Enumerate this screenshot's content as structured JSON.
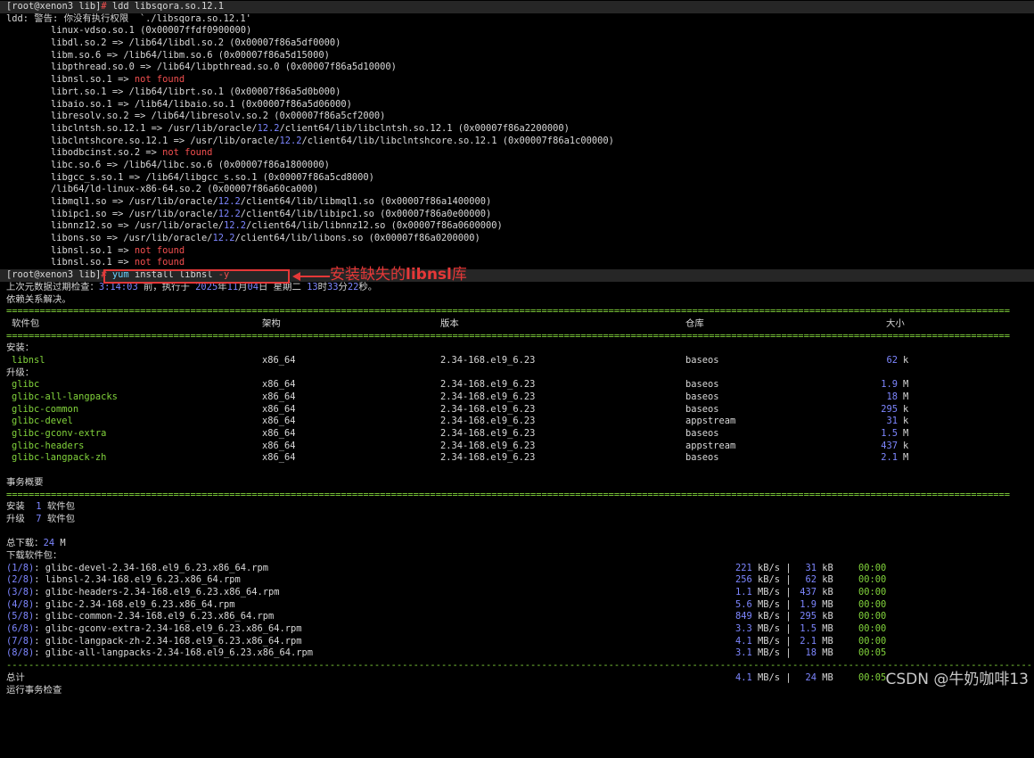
{
  "ldd": {
    "prompt": "[root@xenon3 lib]",
    "hash": "#",
    "command": "ldd libsqora.so.12.1",
    "warning": "ldd: 警告: 你没有执行权限  `./libsqora.so.12.1'",
    "entries": [
      {
        "lib": "linux-vdso.so.1",
        "arrow": "",
        "target": "",
        "ver": "",
        "rest": "",
        "addr": "(0x00007ffdf0900000)"
      },
      {
        "lib": "libdl.so.2",
        "arrow": "=>",
        "target": "/lib64/libdl.so.2",
        "ver": "",
        "rest": "",
        "addr": "(0x00007f86a5df0000)"
      },
      {
        "lib": "libm.so.6",
        "arrow": "=>",
        "target": "/lib64/libm.so.6",
        "ver": "",
        "rest": "",
        "addr": "(0x00007f86a5d15000)"
      },
      {
        "lib": "libpthread.so.0",
        "arrow": "=>",
        "target": "/lib64/libpthread.so.0",
        "ver": "",
        "rest": "",
        "addr": "(0x00007f86a5d10000)"
      },
      {
        "lib": "libnsl.so.1",
        "arrow": "=>",
        "target": "not found",
        "notfound": true
      },
      {
        "lib": "librt.so.1",
        "arrow": "=>",
        "target": "/lib64/librt.so.1",
        "ver": "",
        "rest": "",
        "addr": "(0x00007f86a5d0b000)"
      },
      {
        "lib": "libaio.so.1",
        "arrow": "=>",
        "target": "/lib64/libaio.so.1",
        "ver": "",
        "rest": "",
        "addr": "(0x00007f86a5d06000)"
      },
      {
        "lib": "libresolv.so.2",
        "arrow": "=>",
        "target": "/lib64/libresolv.so.2",
        "ver": "",
        "rest": "",
        "addr": "(0x00007f86a5cf2000)"
      },
      {
        "lib": "libclntsh.so.12.1",
        "arrow": "=>",
        "target": "/usr/lib/oracle/",
        "ver": "12.2",
        "rest": "/client64/lib/libclntsh.so.12.1",
        "addr": "(0x00007f86a2200000)"
      },
      {
        "lib": "libclntshcore.so.12.1",
        "arrow": "=>",
        "target": "/usr/lib/oracle/",
        "ver": "12.2",
        "rest": "/client64/lib/libclntshcore.so.12.1",
        "addr": "(0x00007f86a1c00000)"
      },
      {
        "lib": "libodbcinst.so.2",
        "arrow": "=>",
        "target": "not found",
        "notfound": true
      },
      {
        "lib": "libc.so.6",
        "arrow": "=>",
        "target": "/lib64/libc.so.6",
        "ver": "",
        "rest": "",
        "addr": "(0x00007f86a1800000)"
      },
      {
        "lib": "libgcc_s.so.1",
        "arrow": "=>",
        "target": "/lib64/libgcc_s.so.1",
        "ver": "",
        "rest": "",
        "addr": "(0x00007f86a5cd8000)"
      },
      {
        "lib": "/lib64/ld-linux-x86-64.so.2",
        "arrow": "",
        "target": "",
        "ver": "",
        "rest": "",
        "addr": "(0x00007f86a60ca000)"
      },
      {
        "lib": "libmql1.so",
        "arrow": "=>",
        "target": "/usr/lib/oracle/",
        "ver": "12.2",
        "rest": "/client64/lib/libmql1.so",
        "addr": "(0x00007f86a1400000)"
      },
      {
        "lib": "libipc1.so",
        "arrow": "=>",
        "target": "/usr/lib/oracle/",
        "ver": "12.2",
        "rest": "/client64/lib/libipc1.so",
        "addr": "(0x00007f86a0e00000)"
      },
      {
        "lib": "libnnz12.so",
        "arrow": "=>",
        "target": "/usr/lib/oracle/",
        "ver": "12.2",
        "rest": "/client64/lib/libnnz12.so",
        "addr": "(0x00007f86a0600000)"
      },
      {
        "lib": "libons.so",
        "arrow": "=>",
        "target": "/usr/lib/oracle/",
        "ver": "12.2",
        "rest": "/client64/lib/libons.so",
        "addr": "(0x00007f86a0200000)"
      },
      {
        "lib": "libnsl.so.1",
        "arrow": "=>",
        "target": "not found",
        "notfound": true
      },
      {
        "lib": "libnsl.so.1",
        "arrow": "=>",
        "target": "not found",
        "notfound": true
      }
    ]
  },
  "yum": {
    "prompt": "[root@xenon3 lib]",
    "hash": "#",
    "cmd_yum": "yum",
    "cmd_rest": "install libnsl ",
    "cmd_flag": "-y",
    "metadata_pre": "上次元数据过期检查：",
    "metadata_time": "3:14:03",
    "metadata_mid": " 前，执行于 ",
    "metadata_year": "2025",
    "metadata_y": "年",
    "metadata_month": "11",
    "metadata_m": "月",
    "metadata_day": "04",
    "metadata_d": "日 星期二 ",
    "metadata_hour": "13",
    "metadata_h": "时",
    "metadata_min": "33",
    "metadata_mm": "分",
    "metadata_sec": "22",
    "metadata_s": "秒。",
    "resolved": "依赖关系解决。",
    "separator_eq": "====================================================================================================================================================================================",
    "separator_dash": "--------------------------------------------------------------------------------------------------------------------------------------------------------------------------------------------------------------------------",
    "headers": {
      "pkg": "软件包",
      "arch": "架构",
      "ver": "版本",
      "repo": "仓库",
      "size": "大小"
    },
    "install_label": "安装：",
    "upgrade_label": "升级：",
    "install_pkgs": [
      {
        "name": "libnsl",
        "arch": "x86_64",
        "ver": "2.34-168.el9_6.23",
        "repo": "baseos",
        "size": "62",
        "unit": "k"
      }
    ],
    "upgrade_pkgs": [
      {
        "name": "glibc",
        "arch": "x86_64",
        "ver": "2.34-168.el9_6.23",
        "repo": "baseos",
        "size": "1.9",
        "unit": "M"
      },
      {
        "name": "glibc-all-langpacks",
        "arch": "x86_64",
        "ver": "2.34-168.el9_6.23",
        "repo": "baseos",
        "size": "18",
        "unit": "M"
      },
      {
        "name": "glibc-common",
        "arch": "x86_64",
        "ver": "2.34-168.el9_6.23",
        "repo": "baseos",
        "size": "295",
        "unit": "k"
      },
      {
        "name": "glibc-devel",
        "arch": "x86_64",
        "ver": "2.34-168.el9_6.23",
        "repo": "appstream",
        "size": "31",
        "unit": "k"
      },
      {
        "name": "glibc-gconv-extra",
        "arch": "x86_64",
        "ver": "2.34-168.el9_6.23",
        "repo": "baseos",
        "size": "1.5",
        "unit": "M"
      },
      {
        "name": "glibc-headers",
        "arch": "x86_64",
        "ver": "2.34-168.el9_6.23",
        "repo": "appstream",
        "size": "437",
        "unit": "k"
      },
      {
        "name": "glibc-langpack-zh",
        "arch": "x86_64",
        "ver": "2.34-168.el9_6.23",
        "repo": "baseos",
        "size": "2.1",
        "unit": "M"
      }
    ],
    "summary_title": "事务概要",
    "summary_install": {
      "label": "安装  ",
      "count": "1",
      "unit": " 软件包"
    },
    "summary_upgrade": {
      "label": "升级  ",
      "count": "7",
      "unit": " 软件包"
    },
    "total_download": {
      "label": "总下载：",
      "value": "24",
      "unit": " M"
    },
    "downloading_label": "下载软件包：",
    "downloads": [
      {
        "idx": "(1/8)",
        "file": ": glibc-devel-2.34-168.el9_6.23.x86_64.rpm",
        "speed": "221",
        "sunit": " kB/s",
        "size": "31",
        "kunit": " kB",
        "time": "00:00"
      },
      {
        "idx": "(2/8)",
        "file": ": libnsl-2.34-168.el9_6.23.x86_64.rpm",
        "speed": "256",
        "sunit": " kB/s",
        "size": "62",
        "kunit": " kB",
        "time": "00:00"
      },
      {
        "idx": "(3/8)",
        "file": ": glibc-headers-2.34-168.el9_6.23.x86_64.rpm",
        "speed": "1.1",
        "sunit": " MB/s",
        "size": "437",
        "kunit": " kB",
        "time": "00:00"
      },
      {
        "idx": "(4/8)",
        "file": ": glibc-2.34-168.el9_6.23.x86_64.rpm",
        "speed": "5.6",
        "sunit": " MB/s",
        "size": "1.9",
        "kunit": " MB",
        "time": "00:00"
      },
      {
        "idx": "(5/8)",
        "file": ": glibc-common-2.34-168.el9_6.23.x86_64.rpm",
        "speed": "849",
        "sunit": " kB/s",
        "size": "295",
        "kunit": " kB",
        "time": "00:00"
      },
      {
        "idx": "(6/8)",
        "file": ": glibc-gconv-extra-2.34-168.el9_6.23.x86_64.rpm",
        "speed": "3.3",
        "sunit": " MB/s",
        "size": "1.5",
        "kunit": " MB",
        "time": "00:00"
      },
      {
        "idx": "(7/8)",
        "file": ": glibc-langpack-zh-2.34-168.el9_6.23.x86_64.rpm",
        "speed": "4.1",
        "sunit": " MB/s",
        "size": "2.1",
        "kunit": " MB",
        "time": "00:00"
      },
      {
        "idx": "(8/8)",
        "file": ": glibc-all-langpacks-2.34-168.el9_6.23.x86_64.rpm",
        "speed": "3.1",
        "sunit": " MB/s",
        "size": "18",
        "kunit": " MB",
        "time": "00:05"
      }
    ],
    "total": {
      "label": "总计",
      "speed": "4.1",
      "sunit": " MB/s",
      "size": "24",
      "kunit": " MB",
      "time": "00:05"
    },
    "last_line": "运行事务检查"
  },
  "annotation": {
    "text_pre": "安装缺失的",
    "text_bold": "libnsl",
    "text_post": "库",
    "color": "#e53838"
  },
  "watermark": "CSDN @牛奶咖啡13",
  "colors": {
    "background": "#000000",
    "text": "#d8d8d8",
    "red": "#f34f4f",
    "blue": "#7d86ff",
    "green": "#82d43c",
    "cyan": "#6ad2ff"
  }
}
